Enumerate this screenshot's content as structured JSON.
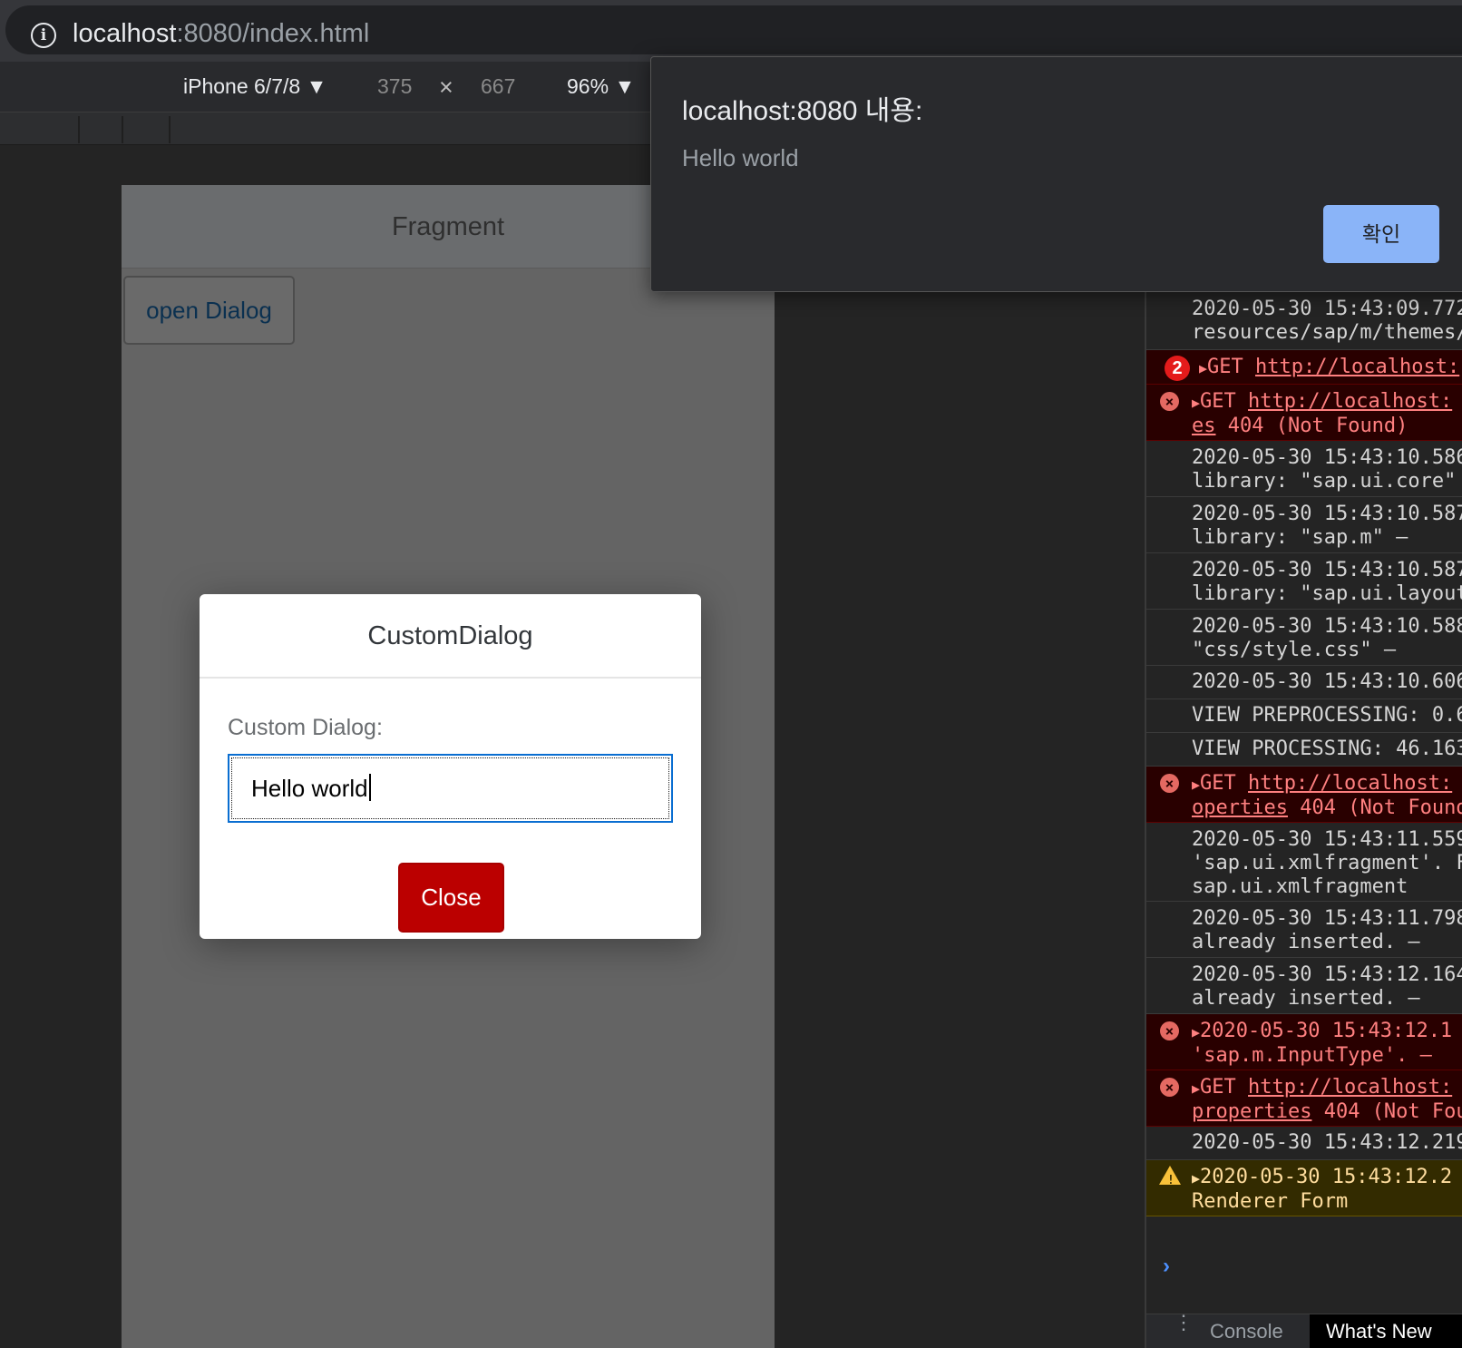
{
  "browser": {
    "url_host": "localhost",
    "url_rest": ":8080/index.html"
  },
  "device_toolbar": {
    "device": "iPhone 6/7/8",
    "width": "375",
    "times": "×",
    "height": "667",
    "zoom": "96%"
  },
  "app": {
    "page_title": "Fragment",
    "open_dialog_label": "open Dialog",
    "dialog": {
      "title": "CustomDialog",
      "field_label": "Custom Dialog:",
      "input_value": "Hello world",
      "close_label": "Close"
    }
  },
  "alert": {
    "title": "localhost:8080 내용:",
    "message": "Hello world",
    "ok_label": "확인"
  },
  "console": {
    "entries": [
      {
        "type": "log",
        "line1": "2020-05-30 15:43:09.772",
        "line2": "resources/sap/m/themes/"
      },
      {
        "type": "error-group",
        "count": "2",
        "method": "GET",
        "url": "http://localhost:"
      },
      {
        "type": "error",
        "method": "GET",
        "url": "http://localhost:",
        "url_cont": "es",
        "status": " 404 (Not Found)"
      },
      {
        "type": "log",
        "line1": "2020-05-30 15:43:10.586",
        "line2": "library: \"sap.ui.core\""
      },
      {
        "type": "log",
        "line1": "2020-05-30 15:43:10.587",
        "line2": "library: \"sap.m\" –"
      },
      {
        "type": "log",
        "line1": "2020-05-30 15:43:10.587",
        "line2": "library: \"sap.ui.layout"
      },
      {
        "type": "log",
        "line1": "2020-05-30 15:43:10.588",
        "line2": "\"css/style.css\" –"
      },
      {
        "type": "log",
        "line1": "2020-05-30 15:43:10.606"
      },
      {
        "type": "log",
        "line1": "VIEW PREPROCESSING: 0.6"
      },
      {
        "type": "log",
        "line1": "VIEW PROCESSING: 46.163"
      },
      {
        "type": "error",
        "method": "GET",
        "url": "http://localhost:",
        "url_cont": "operties",
        "status": " 404 (Not Found"
      },
      {
        "type": "log",
        "line1": "2020-05-30 15:43:11.559",
        "line2": "'sap.ui.xmlfragment'. F",
        "line3": "sap.ui.xmlfragment"
      },
      {
        "type": "log",
        "line1": "2020-05-30 15:43:11.798",
        "line2": "already inserted. –"
      },
      {
        "type": "log",
        "line1": "2020-05-30 15:43:12.164",
        "line2": "already inserted. –"
      },
      {
        "type": "error-text",
        "line1": "2020-05-30 15:43:12.1",
        "line2": "'sap.m.InputType'. –"
      },
      {
        "type": "error",
        "method": "GET",
        "url": "http://localhost:",
        "url_cont": "properties",
        "status": " 404 (Not Fou"
      },
      {
        "type": "log",
        "line1": "2020-05-30 15:43:12.219"
      },
      {
        "type": "warn",
        "line1": "2020-05-30 15:43:12.2",
        "line2": "Renderer Form"
      }
    ],
    "prompt": "›",
    "tabs": {
      "console": "Console",
      "whats_new": "What's New"
    }
  },
  "colors": {
    "dialog_close": "#bb0000",
    "alert_ok": "#8ab4f8",
    "console_error_bg": "#290000",
    "console_warn_bg": "#332b00"
  }
}
